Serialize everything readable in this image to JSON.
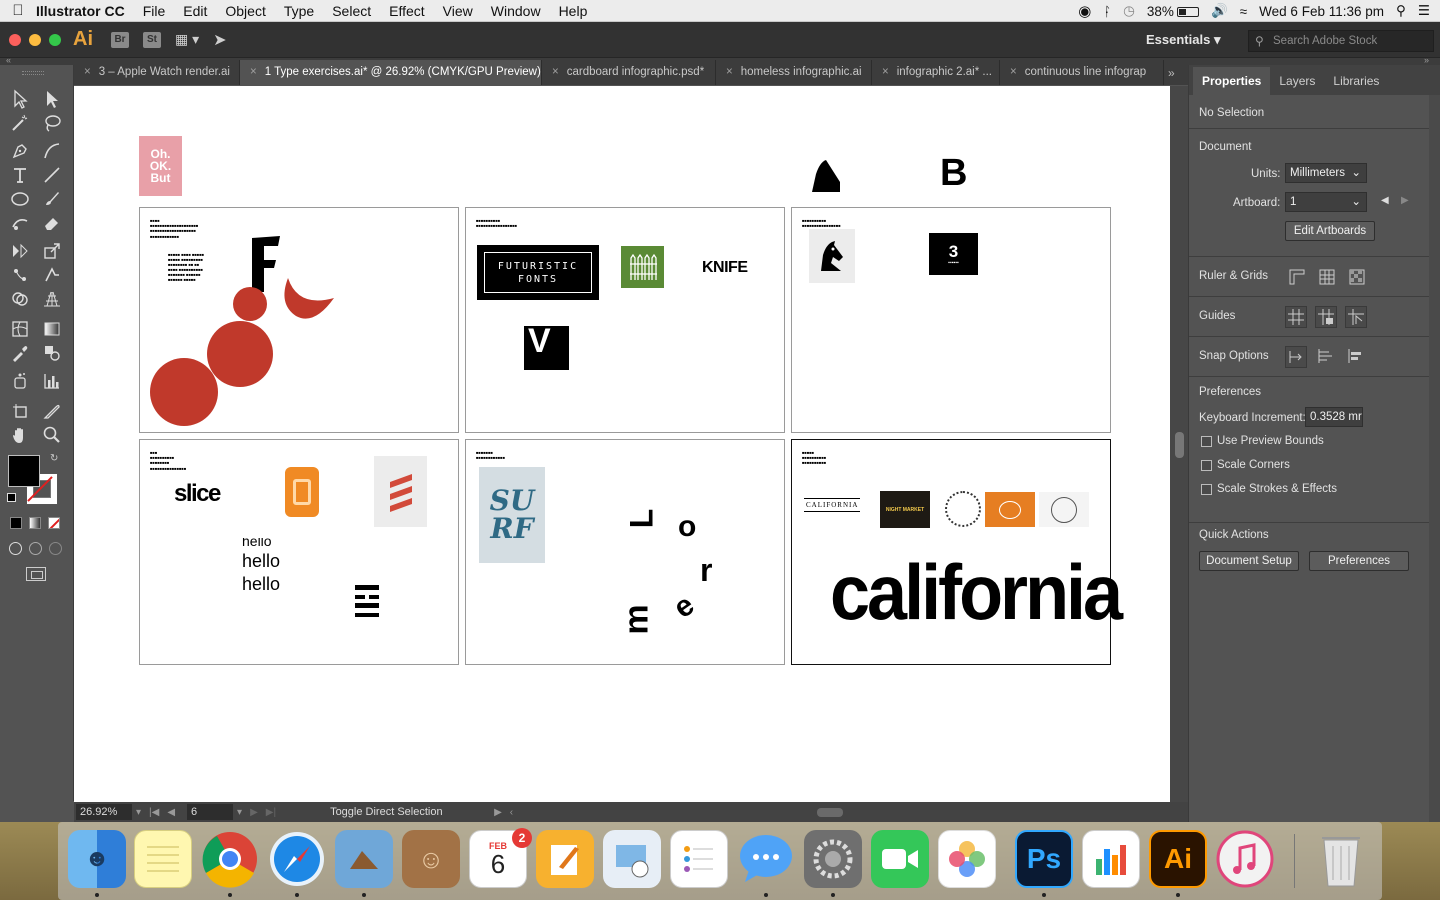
{
  "menubar": {
    "apple": "",
    "app_name": "Illustrator CC",
    "items": [
      "File",
      "Edit",
      "Object",
      "Type",
      "Select",
      "Effect",
      "View",
      "Window",
      "Help"
    ],
    "battery": "38%",
    "datetime": "Wed 6 Feb  11:36 pm"
  },
  "appbar": {
    "logo": "Ai",
    "br": "Br",
    "st": "St",
    "workspace": "Essentials",
    "search_placeholder": "Search Adobe Stock"
  },
  "tabs": [
    {
      "label": "3 – Apple Watch render.ai",
      "active": false
    },
    {
      "label": "1 Type exercises.ai* @ 26.92% (CMYK/GPU Preview)",
      "active": true
    },
    {
      "label": "cardboard infographic.psd*",
      "active": false
    },
    {
      "label": "homeless infographic.ai",
      "active": false
    },
    {
      "label": "infographic 2.ai* ...",
      "active": false
    },
    {
      "label": "continuous line infograp",
      "active": false
    }
  ],
  "artwork": {
    "ohokbut": [
      "Oh.",
      "OK.",
      "But"
    ],
    "futuristic": [
      "FUTURISTIC",
      "FONTS"
    ],
    "knife": "KNIFE",
    "v": "V",
    "slice": "slice",
    "hello1": "hello",
    "hello2": "hello",
    "b_letter": "B",
    "b_box": "3",
    "surf": [
      "SU",
      "RF"
    ],
    "lorem": [
      "L",
      "o",
      "r",
      "e",
      "m"
    ],
    "california_big": "california",
    "california_logo": "CALIFORNIA",
    "night_market": "NIGHT MARKET"
  },
  "status": {
    "zoom": "26.92%",
    "page": "6",
    "tool_hint": "Toggle Direct Selection"
  },
  "panel": {
    "tabs": [
      "Properties",
      "Layers",
      "Libraries"
    ],
    "selection": "No Selection",
    "document_title": "Document",
    "units_label": "Units:",
    "units_value": "Millimeters",
    "artboard_label": "Artboard:",
    "artboard_value": "1",
    "edit_artboards": "Edit Artboards",
    "ruler_grids": "Ruler & Grids",
    "guides": "Guides",
    "snap_options": "Snap Options",
    "preferences_title": "Preferences",
    "keyboard_increment_label": "Keyboard Increment:",
    "keyboard_increment_value": "0.3528 mr",
    "checkboxes": [
      "Use Preview Bounds",
      "Scale Corners",
      "Scale Strokes & Effects"
    ],
    "quick_actions": "Quick Actions",
    "document_setup": "Document Setup",
    "preferences_btn": "Preferences"
  },
  "dock": {
    "calendar_month": "FEB",
    "calendar_day": "6",
    "calendar_badge": "2",
    "ps": "Ps",
    "ai": "Ai"
  }
}
